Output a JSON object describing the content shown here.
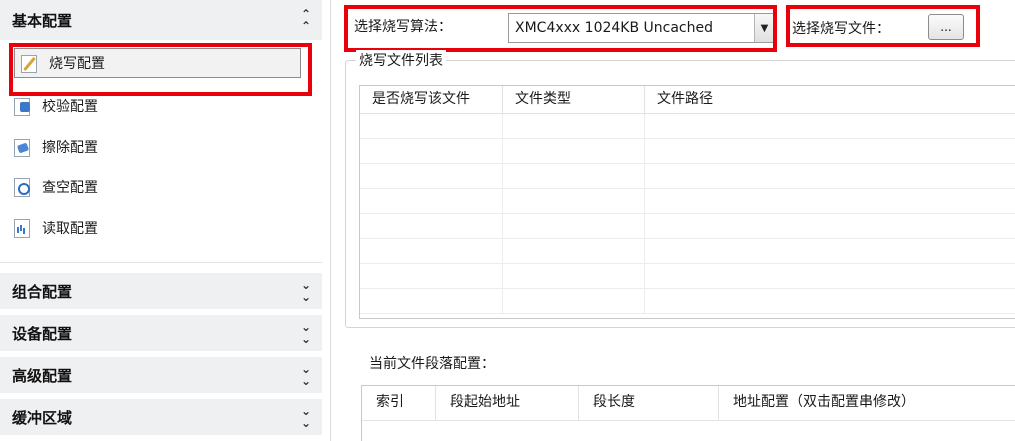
{
  "sidebar": {
    "basic": {
      "title": "基本配置",
      "collapse_icon": "chevron-up-icon",
      "items": [
        {
          "label": "烧写配置",
          "icon": "edit-doc-icon",
          "selected": true
        },
        {
          "label": "校验配置",
          "icon": "verify-doc-icon"
        },
        {
          "label": "擦除配置",
          "icon": "erase-doc-icon"
        },
        {
          "label": "查空配置",
          "icon": "blank-check-doc-icon"
        },
        {
          "label": "读取配置",
          "icon": "read-doc-icon"
        }
      ]
    },
    "sections": [
      {
        "title": "组合配置",
        "expand_icon": "chevron-down-icon"
      },
      {
        "title": "设备配置",
        "expand_icon": "chevron-down-icon"
      },
      {
        "title": "高级配置",
        "expand_icon": "chevron-down-icon"
      },
      {
        "title": "缓冲区域",
        "expand_icon": "chevron-down-icon"
      }
    ]
  },
  "main": {
    "algorithm_label": "选择烧写算法：",
    "algorithm_value": "XMC4xxx 1024KB Uncached",
    "file_label": "选择烧写文件：",
    "browse_label": "...",
    "file_list": {
      "title": "烧写文件列表",
      "columns": [
        "是否烧写该文件",
        "文件类型",
        "文件路径"
      ],
      "rows": []
    },
    "segment": {
      "title": "当前文件段落配置：",
      "columns": [
        "索引",
        "段起始地址",
        "段长度",
        "地址配置（双击配置串修改）"
      ],
      "rows": []
    }
  },
  "colors": {
    "highlight_border": "#e8000b",
    "section_header_bg": "#eff0f2",
    "selected_item_bg": "#f2f2f2"
  }
}
